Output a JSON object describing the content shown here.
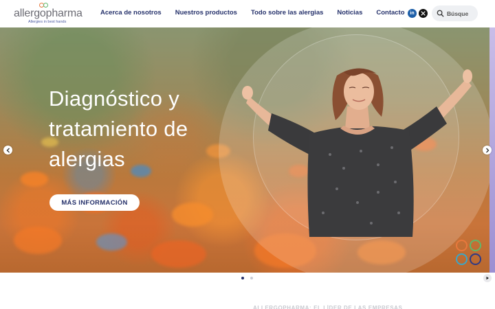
{
  "header": {
    "logo": {
      "brand": "allergopharma",
      "tagline": "Allergies in best hands",
      "ring_colors": [
        "#e8783c",
        "#5fb86a",
        "#3aa6c8",
        "#2d3a86"
      ]
    },
    "nav": [
      {
        "label": "Acerca de nosotros"
      },
      {
        "label": "Nuestros productos"
      },
      {
        "label": "Todo sobre las alergias"
      },
      {
        "label": "Noticias"
      },
      {
        "label": "Contacto"
      }
    ],
    "social": {
      "linkedin": "in",
      "x": "𝕏"
    },
    "search": {
      "placeholder": "Búsque"
    }
  },
  "hero": {
    "title": "Diagnóstico y tratamiento de alergias",
    "button_label": "MÁS INFORMACIÓN",
    "prev_icon": "chevron-left-icon",
    "next_icon": "chevron-right-icon",
    "ring_colors": [
      "#e8783c",
      "#5fb86a",
      "#3aa6c8",
      "#2d3a86"
    ]
  },
  "carousel": {
    "slide_count": 2,
    "active_index": 0,
    "dot_active_color": "#24306a",
    "dot_inactive_color": "#c9ccd6"
  },
  "section_heading_partial": "ALLERGOPHARMA: EL LÍDER DE LAS EMPRESAS",
  "colors": {
    "nav_text": "#24306a",
    "accent": "#24306a"
  }
}
